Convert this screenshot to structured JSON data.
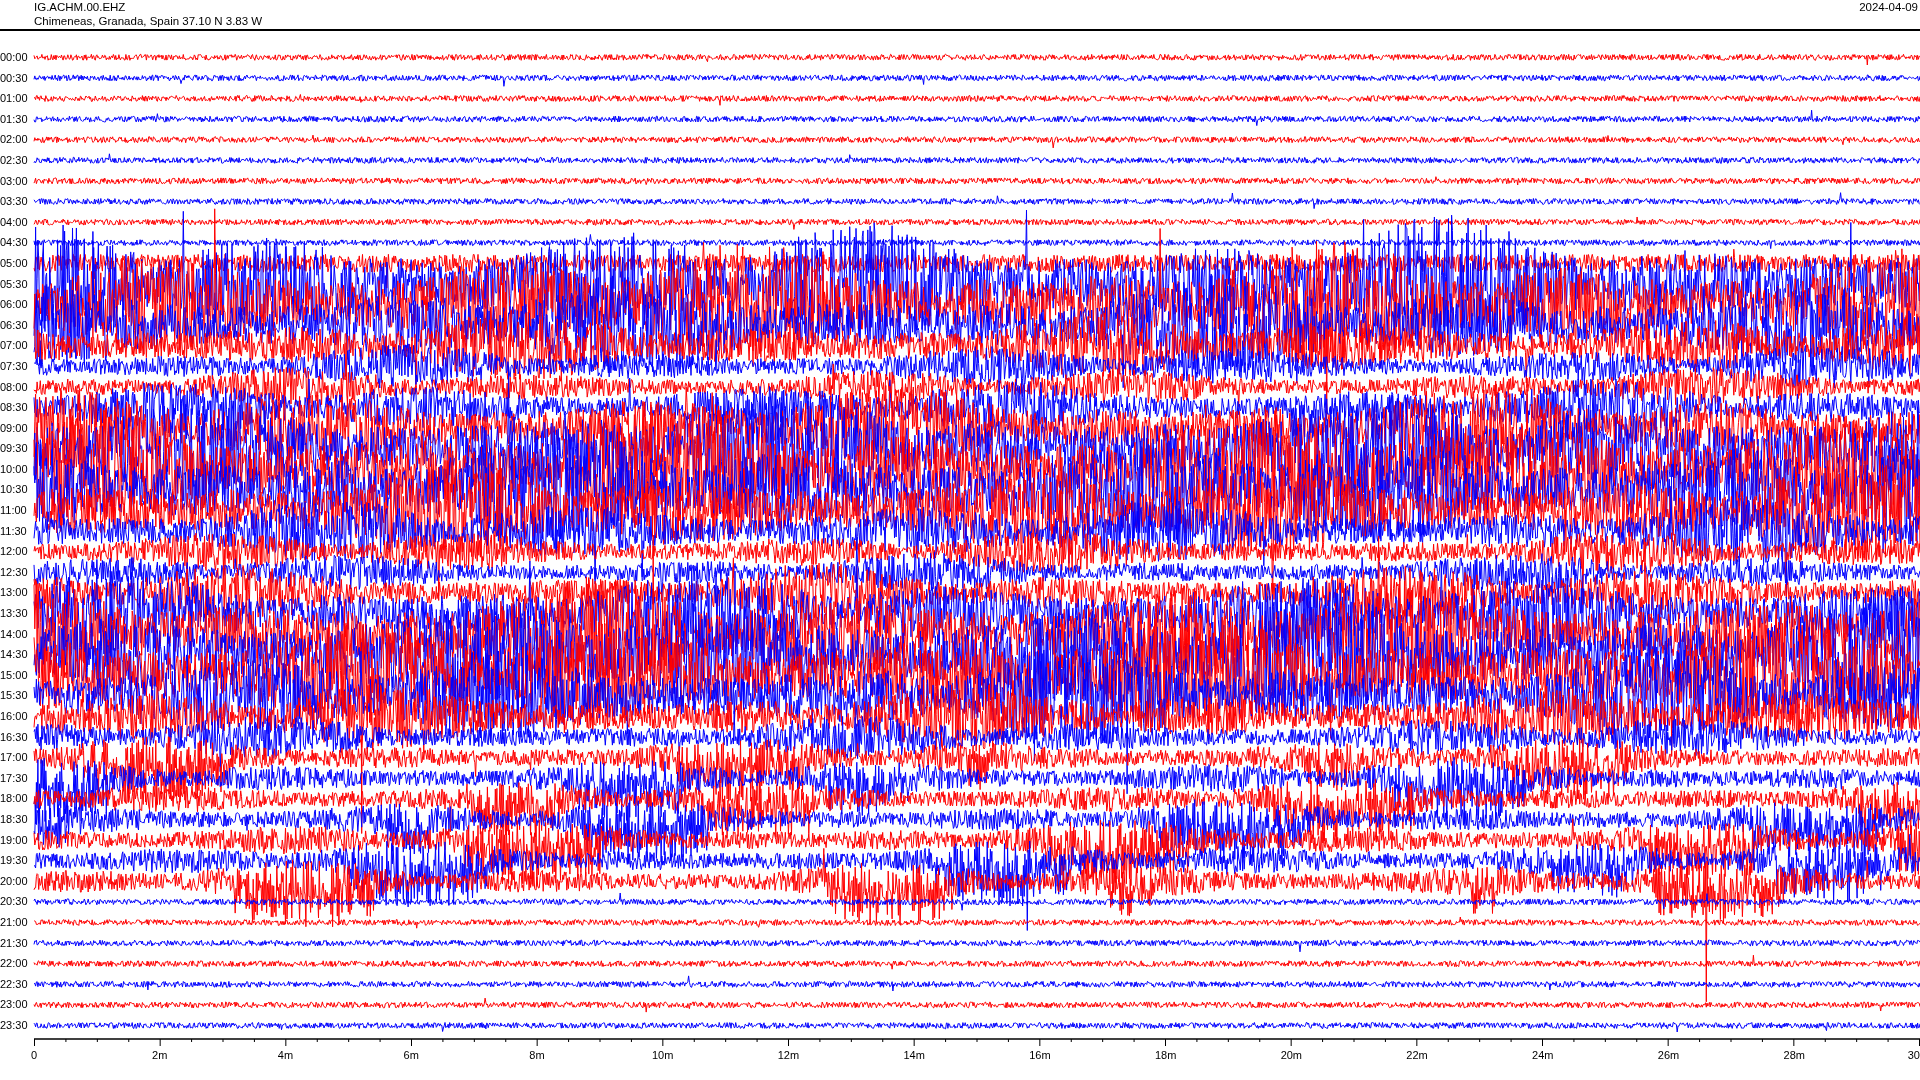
{
  "header": {
    "station": "IG.ACHM.00.EHZ",
    "location": "Chimeneas, Granada, Spain  37.10 N 3.83 W",
    "date": "2024-04-09"
  },
  "traces": [
    {
      "label": "00:00"
    },
    {
      "label": "00:30"
    },
    {
      "label": "01:00"
    },
    {
      "label": "01:30"
    },
    {
      "label": "02:00"
    },
    {
      "label": "02:30"
    },
    {
      "label": "03:00"
    },
    {
      "label": "03:30"
    },
    {
      "label": "04:00"
    },
    {
      "label": "04:30"
    },
    {
      "label": "05:00"
    },
    {
      "label": "05:30"
    },
    {
      "label": "06:00"
    },
    {
      "label": "06:30"
    },
    {
      "label": "07:00"
    },
    {
      "label": "07:30"
    },
    {
      "label": "08:00"
    },
    {
      "label": "08:30"
    },
    {
      "label": "09:00"
    },
    {
      "label": "09:30"
    },
    {
      "label": "10:00"
    },
    {
      "label": "10:30"
    },
    {
      "label": "11:00"
    },
    {
      "label": "11:30"
    },
    {
      "label": "12:00"
    },
    {
      "label": "12:30"
    },
    {
      "label": "13:00"
    },
    {
      "label": "13:30"
    },
    {
      "label": "14:00"
    },
    {
      "label": "14:30"
    },
    {
      "label": "15:00"
    },
    {
      "label": "15:30"
    },
    {
      "label": "16:00"
    },
    {
      "label": "16:30"
    },
    {
      "label": "17:00"
    },
    {
      "label": "17:30"
    },
    {
      "label": "18:00"
    },
    {
      "label": "18:30"
    },
    {
      "label": "19:00"
    },
    {
      "label": "19:30"
    },
    {
      "label": "20:00"
    },
    {
      "label": "20:30"
    },
    {
      "label": "21:00"
    },
    {
      "label": "21:30"
    },
    {
      "label": "22:00"
    },
    {
      "label": "22:30"
    },
    {
      "label": "23:00"
    },
    {
      "label": "23:30"
    }
  ],
  "x_axis": {
    "ticks": [
      "0",
      "2m",
      "4m",
      "6m",
      "8m",
      "10m",
      "12m",
      "14m",
      "16m",
      "18m",
      "20m",
      "22m",
      "24m",
      "26m",
      "28m",
      "30"
    ]
  }
}
